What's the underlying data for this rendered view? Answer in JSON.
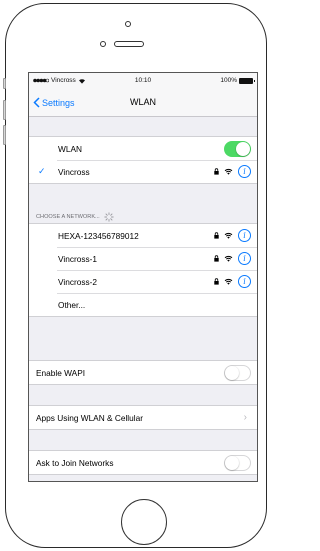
{
  "status_bar": {
    "carrier": "Vincross",
    "time": "10:10",
    "battery": "100%"
  },
  "nav": {
    "back_label": "Settings",
    "title": "WLAN"
  },
  "wlan_group": {
    "wlan_label": "WLAN",
    "wlan_on": true,
    "connected_network": "Vincross"
  },
  "choose_network_header": "CHOOSE A NETWORK...",
  "networks": [
    {
      "name": "HEXA-123456789012"
    },
    {
      "name": "Vincross-1"
    },
    {
      "name": "Vincross-2"
    }
  ],
  "other_label": "Other...",
  "enable_wapi": {
    "label": "Enable WAPI",
    "on": false
  },
  "apps_using": {
    "label": "Apps Using WLAN & Cellular"
  },
  "ask_to_join": {
    "label": "Ask to Join Networks",
    "on": false
  },
  "colors": {
    "accent": "#0a7aff",
    "toggle_on": "#4cd964"
  }
}
